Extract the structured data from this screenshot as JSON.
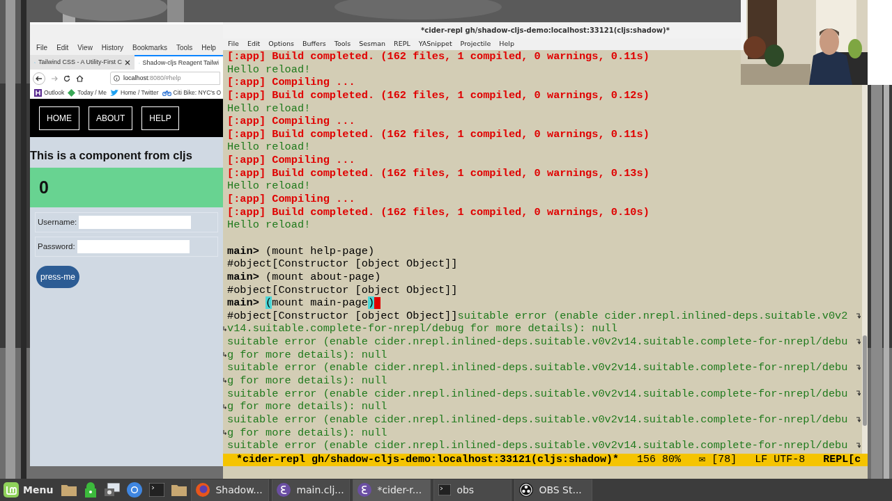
{
  "browser": {
    "menu": [
      "File",
      "Edit",
      "View",
      "History",
      "Bookmarks",
      "Tools",
      "Help"
    ],
    "tabs": [
      {
        "title": "Tailwind CSS - A Utility-First C",
        "selected": false,
        "closable": true
      },
      {
        "title": "Shadow-cljs Reagent Tailwi",
        "selected": true,
        "closable": false
      }
    ],
    "url": {
      "host": "localhost",
      "rest": ":8080/#help"
    },
    "bookmarks": [
      {
        "label": "Outlook",
        "kind": "letter-h"
      },
      {
        "label": "Today / Me",
        "kind": "diamond"
      },
      {
        "label": "Home / Twitter",
        "kind": "bird"
      },
      {
        "label": "Citi Bike: NYC's O",
        "kind": "bike"
      }
    ],
    "page": {
      "nav": [
        "HOME",
        "ABOUT",
        "HELP"
      ],
      "heading": "This is a component from cljs",
      "counter": "0",
      "fields": [
        {
          "label": "Username:"
        },
        {
          "label": "Password:"
        }
      ],
      "button": "press-me"
    }
  },
  "emacs": {
    "title": "*cider-repl gh/shadow-cljs-demo:localhost:33121(cljs:shadow)*",
    "menu": [
      "File",
      "Edit",
      "Options",
      "Buffers",
      "Tools",
      "Sesman",
      "REPL",
      "YASnippet",
      "Projectile",
      "Help"
    ],
    "lines": [
      {
        "segments": [
          {
            "text": "[:app] Build completed. (162 files, 1 compiled, 0 warnings, 0.11s)",
            "kind": "error"
          }
        ]
      },
      {
        "segments": [
          {
            "text": "Hello reload!",
            "kind": "output"
          }
        ]
      },
      {
        "segments": [
          {
            "text": "[:app] Compiling ...",
            "kind": "error"
          }
        ]
      },
      {
        "segments": [
          {
            "text": "[:app] Build completed. (162 files, 1 compiled, 0 warnings, 0.12s)",
            "kind": "error"
          }
        ]
      },
      {
        "segments": [
          {
            "text": "Hello reload!",
            "kind": "output"
          }
        ]
      },
      {
        "segments": [
          {
            "text": "[:app] Compiling ...",
            "kind": "error"
          }
        ]
      },
      {
        "segments": [
          {
            "text": "[:app] Build completed. (162 files, 1 compiled, 0 warnings, 0.11s)",
            "kind": "error"
          }
        ]
      },
      {
        "segments": [
          {
            "text": "Hello reload!",
            "kind": "output"
          }
        ]
      },
      {
        "segments": [
          {
            "text": "[:app] Compiling ...",
            "kind": "error"
          }
        ]
      },
      {
        "segments": [
          {
            "text": "[:app] Build completed. (162 files, 1 compiled, 0 warnings, 0.13s)",
            "kind": "error"
          }
        ]
      },
      {
        "segments": [
          {
            "text": "Hello reload!",
            "kind": "output"
          }
        ]
      },
      {
        "segments": [
          {
            "text": "[:app] Compiling ...",
            "kind": "error"
          }
        ]
      },
      {
        "segments": [
          {
            "text": "[:app] Build completed. (162 files, 1 compiled, 0 warnings, 0.10s)",
            "kind": "error"
          }
        ]
      },
      {
        "segments": [
          {
            "text": "Hello reload!",
            "kind": "output"
          }
        ]
      },
      {
        "segments": [
          {
            "text": "main>",
            "kind": "prompt"
          },
          {
            "text": "(mount help-page)",
            "kind": "input"
          }
        ],
        "blank_before": true
      },
      {
        "segments": [
          {
            "text": "#object[Constructor [object Object]]",
            "kind": "result"
          }
        ]
      },
      {
        "segments": [
          {
            "text": "main>",
            "kind": "prompt"
          },
          {
            "text": "(mount about-page)",
            "kind": "input"
          }
        ]
      },
      {
        "segments": [
          {
            "text": "#object[Constructor [object Object]]",
            "kind": "result"
          }
        ]
      },
      {
        "segments": [
          {
            "text": "main>",
            "kind": "prompt"
          },
          {
            "text": "(",
            "kind": "match"
          },
          {
            "text": "mount main-page",
            "kind": "input"
          },
          {
            "text": ")",
            "kind": "match"
          }
        ],
        "cursor": true
      },
      {
        "segments": [
          {
            "text": "#object[Constructor [object Object]]",
            "kind": "result"
          },
          {
            "text": "suitable error (enable cider.nrepl.inlined-deps.suitable.v0v2",
            "kind": "output"
          }
        ],
        "wraps": true
      },
      {
        "segments": [
          {
            "text": "v14.suitable.complete-for-nrepl/debug for more details): null",
            "kind": "output"
          }
        ],
        "continued": true
      },
      {
        "segments": [
          {
            "text": "suitable error (enable cider.nrepl.inlined-deps.suitable.v0v2v14.suitable.complete-for-nrepl/debu",
            "kind": "output"
          }
        ],
        "wraps": true
      },
      {
        "segments": [
          {
            "text": "g for more details): null",
            "kind": "output"
          }
        ],
        "continued": true
      },
      {
        "segments": [
          {
            "text": "suitable error (enable cider.nrepl.inlined-deps.suitable.v0v2v14.suitable.complete-for-nrepl/debu",
            "kind": "output"
          }
        ],
        "wraps": true
      },
      {
        "segments": [
          {
            "text": "g for more details): null",
            "kind": "output"
          }
        ],
        "continued": true
      },
      {
        "segments": [
          {
            "text": "suitable error (enable cider.nrepl.inlined-deps.suitable.v0v2v14.suitable.complete-for-nrepl/debu",
            "kind": "output"
          }
        ],
        "wraps": true
      },
      {
        "segments": [
          {
            "text": "g for more details): null",
            "kind": "output"
          }
        ],
        "continued": true
      },
      {
        "segments": [
          {
            "text": "suitable error (enable cider.nrepl.inlined-deps.suitable.v0v2v14.suitable.complete-for-nrepl/debu",
            "kind": "output"
          }
        ],
        "wraps": true
      },
      {
        "segments": [
          {
            "text": "g for more details): null",
            "kind": "output"
          }
        ],
        "continued": true
      },
      {
        "segments": [
          {
            "text": "suitable error (enable cider.nrepl.inlined-deps.suitable.v0v2v14.suitable.complete-for-nrepl/debu",
            "kind": "output"
          }
        ],
        "wraps": true
      }
    ],
    "modeline": {
      "buffer": "*cider-repl gh/shadow-cljs-demo:localhost:33121(cljs:shadow)*",
      "position": "156 80%",
      "mail": "✉ [78]",
      "encoding": "LF UTF-8",
      "mode": "REPL[c"
    }
  },
  "taskbar": {
    "menu": "Menu",
    "launchers": [
      {
        "kind": "folder"
      },
      {
        "kind": "lock"
      },
      {
        "kind": "camera"
      },
      {
        "kind": "globe"
      },
      {
        "kind": "terminal"
      },
      {
        "kind": "folder"
      }
    ],
    "windows": [
      {
        "title": "Shadow...",
        "kind": "browser",
        "selected": false
      },
      {
        "title": "main.clj...",
        "kind": "editor",
        "selected": false
      },
      {
        "title": "*cider-r...",
        "kind": "editor",
        "selected": true
      },
      {
        "title": "obs",
        "kind": "terminal",
        "selected": false
      },
      {
        "title": "OBS St...",
        "kind": "recorder",
        "selected": false
      }
    ]
  }
}
